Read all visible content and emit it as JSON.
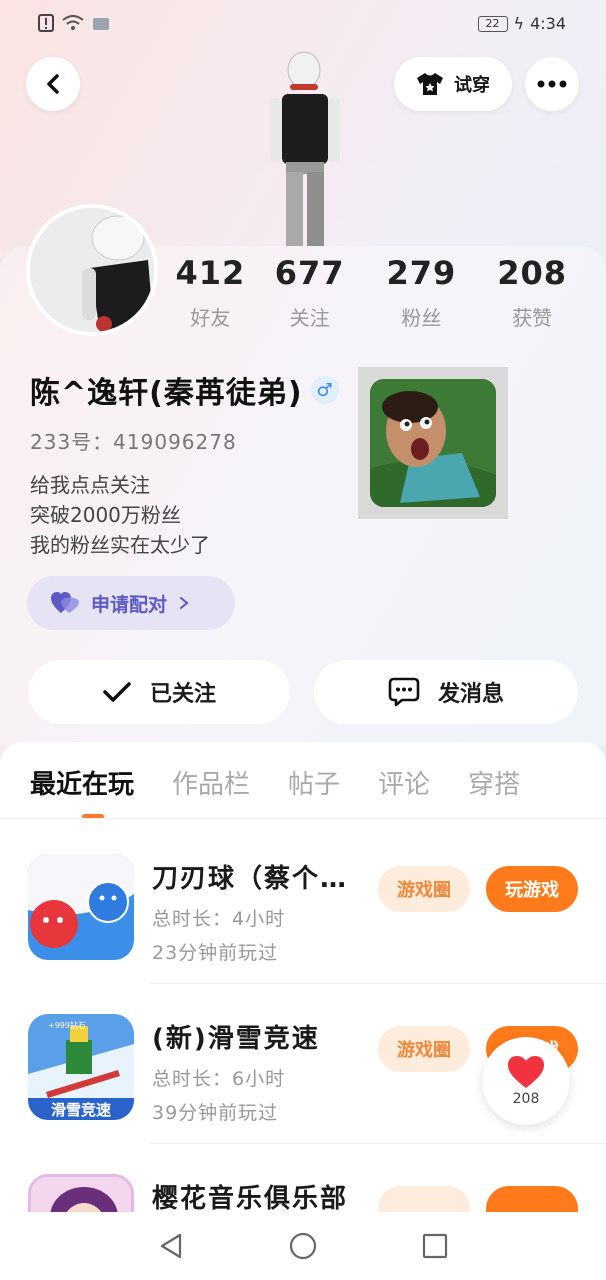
{
  "status_bar": {
    "time": "4:34",
    "battery": "22"
  },
  "header": {
    "try_on_label": "试穿"
  },
  "stats": [
    {
      "value": "412",
      "label": "好友"
    },
    {
      "value": "677",
      "label": "关注"
    },
    {
      "value": "279",
      "label": "粉丝"
    },
    {
      "value": "208",
      "label": "获赞"
    }
  ],
  "profile": {
    "username": "陈^逸轩(秦苒徒弟)",
    "gender_symbol": "♂",
    "uid": "233号：419096278",
    "bio_lines": [
      "给我点点关注",
      "突破2000万粉丝",
      "我的粉丝实在太少了"
    ],
    "pair_label": "申请配对"
  },
  "actions": {
    "follow_label": "已关注",
    "message_label": "发消息"
  },
  "tabs": [
    "最近在玩",
    "作品栏",
    "帖子",
    "评论",
    "穿搭"
  ],
  "games": [
    {
      "name": "刀刃球（蔡个…",
      "duration": "总时长：4小时",
      "last_played": "23分钟前玩过",
      "circle_label": "游戏圈",
      "play_label": "玩游戏"
    },
    {
      "name": "(新)滑雪竞速",
      "duration": "总时长：6小时",
      "last_played": "39分钟前玩过",
      "circle_label": "游戏圈",
      "play_label": "玩游戏",
      "icon_text": "滑雪竞速",
      "icon_badge": "+999钻石"
    },
    {
      "name": "樱花音乐俱乐部"
    }
  ],
  "likes": {
    "count": "208"
  },
  "colors": {
    "accent_orange": "#ff7a1a",
    "pair_purple": "#5d59c7",
    "gender_blue": "#3a86e8"
  }
}
